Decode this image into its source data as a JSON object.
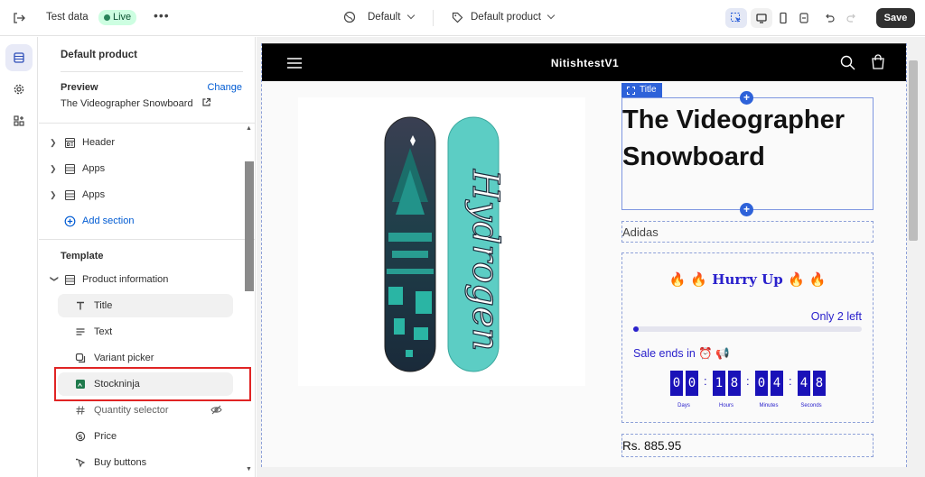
{
  "topbar": {
    "title": "Test data",
    "status": "Live",
    "more": "•••",
    "theme_selector": "Default",
    "template_selector": "Default product",
    "save_label": "Save"
  },
  "sidebar": {
    "title": "Default product",
    "preview_label": "Preview",
    "change_label": "Change",
    "preview_value": "The Videographer Snowboard",
    "sections": [
      {
        "label": "Header"
      },
      {
        "label": "Apps"
      },
      {
        "label": "Apps"
      }
    ],
    "add_section": "Add section",
    "template_label": "Template",
    "product_info": "Product information",
    "blocks": [
      {
        "label": "Title"
      },
      {
        "label": "Text"
      },
      {
        "label": "Variant picker"
      },
      {
        "label": "Stockninja"
      },
      {
        "label": "Quantity selector"
      },
      {
        "label": "Price"
      },
      {
        "label": "Buy buttons"
      }
    ]
  },
  "preview": {
    "store_name": "NitishtestV1",
    "title_tag": "Title",
    "product_title": "The Videographer Snowboard",
    "vendor": "Adidas",
    "stock_widget": {
      "headline": "Hurry Up",
      "headline_emoji_left": "🔥 🔥",
      "headline_emoji_right": "🔥 🔥",
      "remaining": "Only 2 left",
      "remaining_fraction": 0.02,
      "sale_ends": "Sale ends in ⏰ 📢",
      "countdown": {
        "days": "00",
        "hours": "18",
        "minutes": "04",
        "seconds": "48"
      },
      "units": {
        "days": "Days",
        "hours": "Hours",
        "minutes": "Minutes",
        "seconds": "Seconds"
      },
      "colors": {
        "accent": "#2a21cc"
      }
    },
    "price": "Rs. 885.95",
    "board_brand_text": "Hydrogen"
  },
  "colors": {
    "topbar_bg": "#ffffff",
    "save_bg": "#303030",
    "live_bg": "#cdfee1",
    "link": "#005bd3",
    "selection": "#2e62d9",
    "highlight": "#e02424"
  }
}
